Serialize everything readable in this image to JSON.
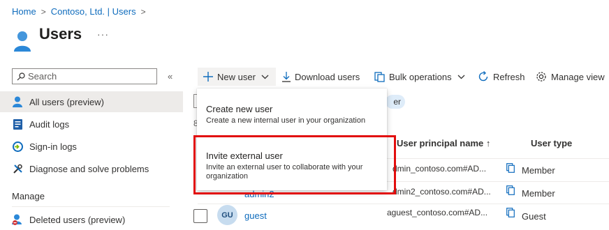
{
  "breadcrumb": [
    "Home",
    "Contoso, Ltd. | Users"
  ],
  "page": {
    "title": "Users",
    "more": "···"
  },
  "search": {
    "placeholder": "Search",
    "collapse": "«"
  },
  "sidebar": {
    "items": [
      {
        "label": "All users (preview)",
        "icon": "user-icon",
        "active": true
      },
      {
        "label": "Audit logs",
        "icon": "audit-log-icon"
      },
      {
        "label": "Sign-in logs",
        "icon": "sign-in-log-icon"
      },
      {
        "label": "Diagnose and solve problems",
        "icon": "wrench-icon"
      }
    ],
    "section": "Manage",
    "manage_items": [
      {
        "label": "Deleted users (preview)",
        "icon": "deleted-user-icon"
      }
    ]
  },
  "toolbar": {
    "new_user": "New user",
    "download": "Download users",
    "bulk": "Bulk operations",
    "refresh": "Refresh",
    "manage_view": "Manage view"
  },
  "filter": {
    "pill": "er",
    "count": "8"
  },
  "table": {
    "headers": {
      "upn": "User principal name ↑",
      "type": "User type"
    },
    "rows": [
      {
        "upn": "dmin_contoso.com#AD...",
        "type": "Member"
      },
      {
        "name": "admin2",
        "upn": "dmin2_contoso.com#AD...",
        "type": "Member"
      },
      {
        "initials": "GU",
        "name": "guest",
        "upn": "aguest_contoso.com#AD...",
        "type": "Guest"
      }
    ]
  },
  "menu": {
    "items": [
      {
        "title": "Create new user",
        "desc": "Create a new internal user in your organization"
      },
      {
        "title": "Invite external user",
        "desc": "Invite an external user to collaborate with your organization"
      }
    ]
  },
  "colors": {
    "accent": "#0f6cbd",
    "highlight": "#e20e0e"
  }
}
